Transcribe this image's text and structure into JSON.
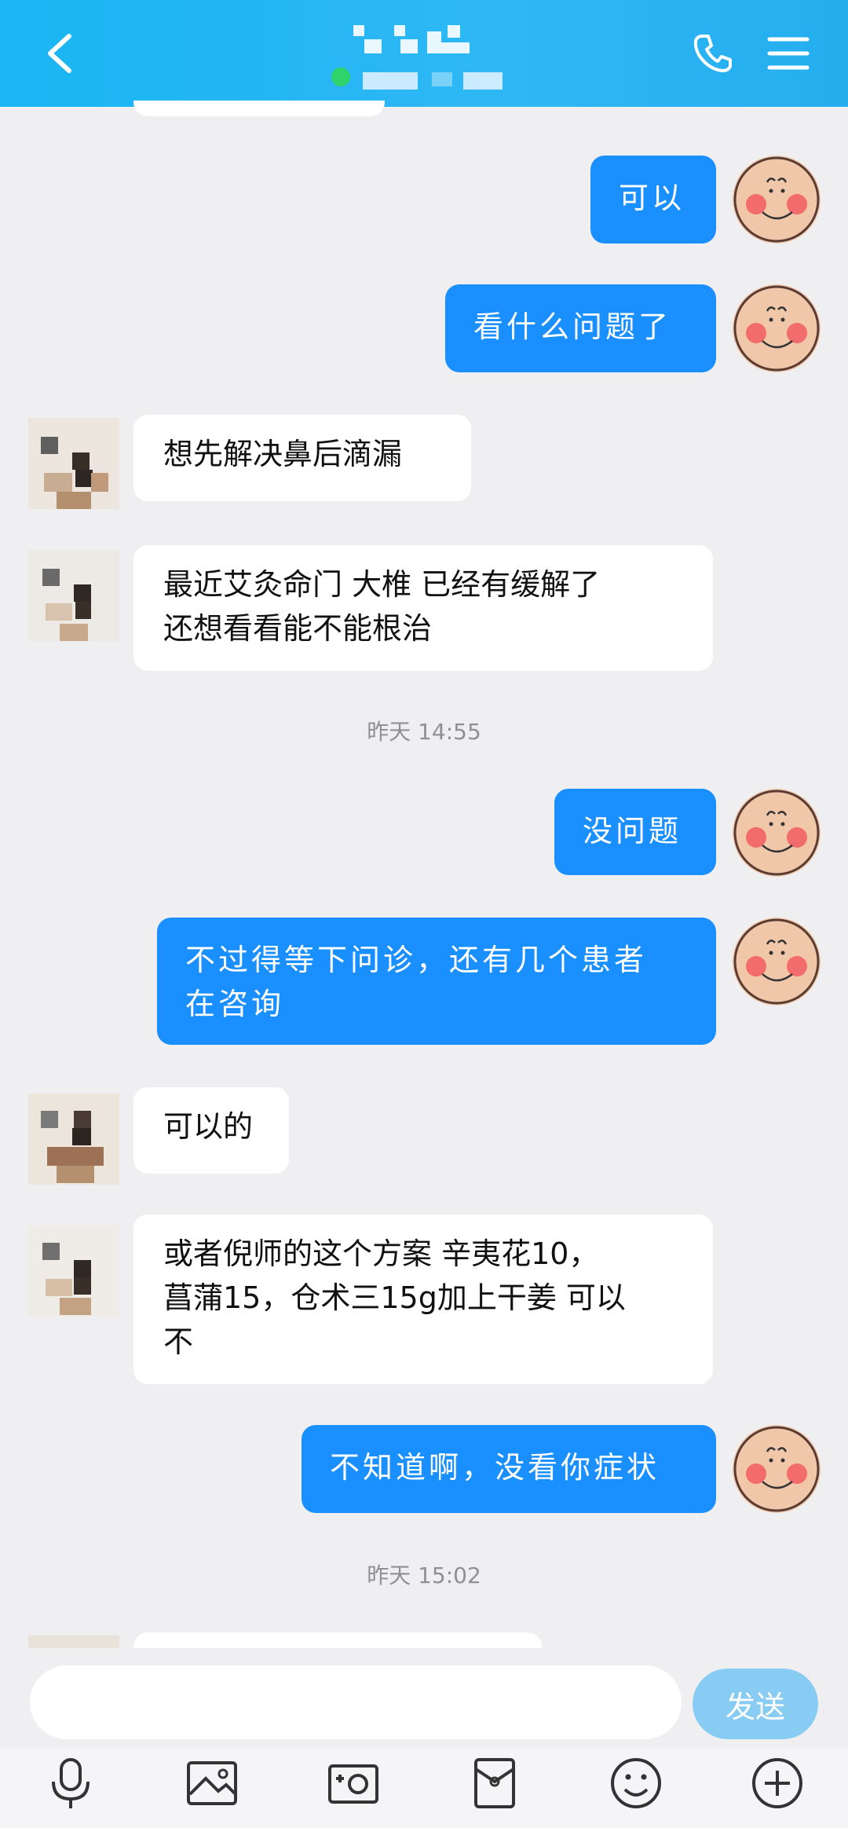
{
  "header": {
    "back_icon": "chevron-left-icon",
    "call_icon": "phone-icon",
    "menu_icon": "hamburger-menu-icon",
    "title_obscured": true,
    "online_status_color": "#2ed36a"
  },
  "messages": [
    {
      "side": "out",
      "text": "可以"
    },
    {
      "side": "out",
      "text": "看什么问题了"
    },
    {
      "side": "in",
      "text": "想先解决鼻后滴漏"
    },
    {
      "side": "in",
      "lines": [
        "最近艾灸命门 大椎 已经有缓解了",
        "还想看看能不能根治"
      ]
    },
    {
      "side": "time",
      "text": "昨天 14:55"
    },
    {
      "side": "out",
      "text": "没问题"
    },
    {
      "side": "out",
      "lines": [
        "不过得等下问诊，还有几个患者",
        "在咨询"
      ]
    },
    {
      "side": "in",
      "text": "可以的"
    },
    {
      "side": "in",
      "lines": [
        "或者倪师的这个方案 辛夷花10，",
        "菖蒲15，仓术三15g加上干姜 可以",
        "不"
      ]
    },
    {
      "side": "out",
      "text": "不知道啊，没看你症状"
    },
    {
      "side": "time",
      "text": "昨天 15:02"
    }
  ],
  "composer": {
    "input_value": "",
    "send_label": "发送"
  },
  "toolbar": {
    "icons": [
      "microphone-icon",
      "image-icon",
      "camera-icon",
      "red-packet-icon",
      "emoji-icon",
      "plus-icon"
    ]
  },
  "colors": {
    "header": "#1fb4f2",
    "outgoing_bubble": "#1a8fff",
    "incoming_bubble": "#ffffff",
    "background": "#efeff1",
    "send_button": "#88ccf3"
  }
}
